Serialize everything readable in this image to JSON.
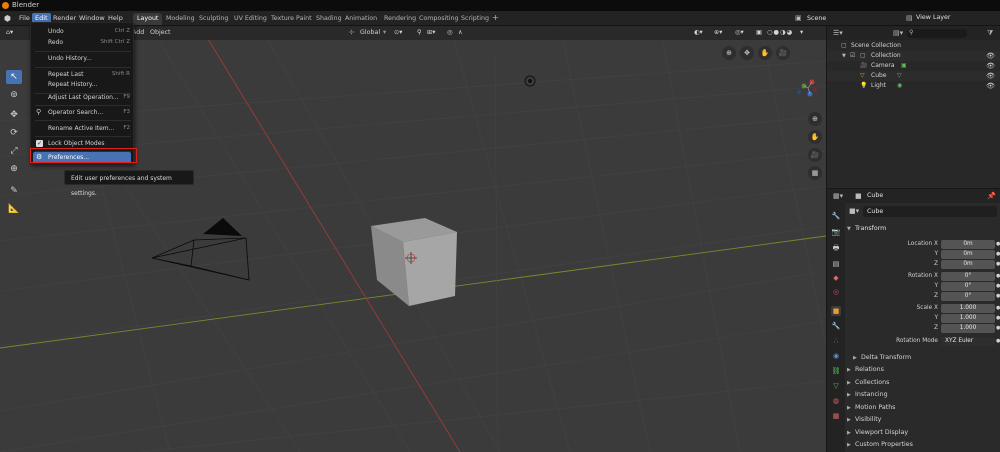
{
  "window": {
    "title": "Blender"
  },
  "menubar": {
    "items": [
      "File",
      "Edit",
      "Render",
      "Window",
      "Help"
    ],
    "active_index": 1
  },
  "workspaces": {
    "tabs": [
      "Layout",
      "Modeling",
      "Sculpting",
      "UV Editing",
      "Texture Paint",
      "Shading",
      "Animation",
      "Rendering",
      "Compositing",
      "Scripting"
    ],
    "active_index": 0,
    "add_label": "+"
  },
  "scene": {
    "label": "Scene"
  },
  "view_layer": {
    "label": "View Layer"
  },
  "viewport_header": {
    "add_label": "Add",
    "object_label": "Object",
    "transform_orientation": "Global"
  },
  "edit_menu": {
    "items": [
      {
        "label": "Undo",
        "shortcut": "Ctrl Z"
      },
      {
        "label": "Redo",
        "shortcut": "Shift Ctrl Z"
      },
      {
        "label": "Undo History...",
        "shortcut": ""
      },
      {
        "label": "Repeat Last",
        "shortcut": "Shift R"
      },
      {
        "label": "Repeat History...",
        "shortcut": ""
      },
      {
        "label": "Adjust Last Operation...",
        "shortcut": "F9"
      },
      {
        "label": "Operator Search...",
        "shortcut": "F3"
      },
      {
        "label": "Rename Active Item...",
        "shortcut": "F2"
      },
      {
        "label": "Lock Object Modes",
        "shortcut": ""
      },
      {
        "label": "Preferences...",
        "shortcut": ""
      }
    ]
  },
  "tooltip": {
    "text": "Edit user preferences and system settings."
  },
  "outliner": {
    "rows": [
      {
        "label": "Scene Collection"
      },
      {
        "label": "Collection"
      },
      {
        "label": "Camera"
      },
      {
        "label": "Cube"
      },
      {
        "label": "Light"
      }
    ]
  },
  "properties": {
    "object_header": "Cube",
    "object_name": "Cube",
    "transform_title": "Transform",
    "location": {
      "label": "Location X",
      "x": "0m",
      "y": "0m",
      "z": "0m"
    },
    "rotation": {
      "label": "Rotation X",
      "x": "0°",
      "y": "0°",
      "z": "0°"
    },
    "scale": {
      "label": "Scale X",
      "x": "1.000",
      "y": "1.000",
      "z": "1.000"
    },
    "axis_y": "Y",
    "axis_z": "Z",
    "rotation_mode_label": "Rotation Mode",
    "rotation_mode_value": "XYZ Euler",
    "delta_transform": "Delta Transform",
    "sections": [
      "Relations",
      "Collections",
      "Instancing",
      "Motion Paths",
      "Visibility",
      "Viewport Display",
      "Custom Properties"
    ]
  },
  "colors": {
    "accent": "#4772b3",
    "highlight_box": "#e1201c",
    "x_axis": "#9d3a3a",
    "y_axis": "#7a8a2a"
  }
}
